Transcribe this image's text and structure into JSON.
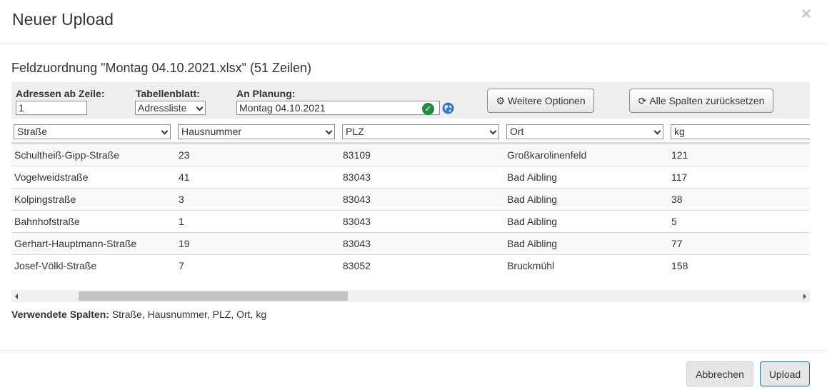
{
  "modal": {
    "title": "Neuer Upload",
    "close_icon": "×"
  },
  "mapping": {
    "subtitle": "Feldzuordnung \"Montag 04.10.2021.xlsx\" (51 Zeilen)"
  },
  "options": {
    "start_row_label": "Adressen ab Zeile:",
    "start_row_value": "1",
    "sheet_label": "Tabellenblatt:",
    "sheet_value": "Adressliste",
    "planning_label": "An Planung:",
    "planning_value": "Montag 04.10.2021",
    "more_options_label": "Weitere Optionen",
    "reset_columns_label": "Alle Spalten zurücksetzen"
  },
  "columns": [
    "Straße",
    "Hausnummer",
    "PLZ",
    "Ort",
    "kg"
  ],
  "rows": [
    [
      "Schultheiß-Gipp-Straße",
      "23",
      "83109",
      "Großkarolinenfeld",
      "121"
    ],
    [
      "Vogelweidstraße",
      "41",
      "83043",
      "Bad Aibling",
      "117"
    ],
    [
      "Kolpingstraße",
      "3",
      "83043",
      "Bad Aibling",
      "38"
    ],
    [
      "Bahnhofstraße",
      "1",
      "83043",
      "Bad Aibling",
      "5"
    ],
    [
      "Gerhart-Hauptmann-Straße",
      "19",
      "83043",
      "Bad Aibling",
      "77"
    ],
    [
      "Josef-Völkl-Straße",
      "7",
      "83052",
      "Bruckmühl",
      "158"
    ]
  ],
  "used_columns": {
    "label": "Verwendete Spalten:",
    "value": "Straße, Hausnummer, PLZ, Ort, kg"
  },
  "footer": {
    "cancel_label": "Abbrechen",
    "upload_label": "Upload"
  },
  "colors": {
    "success": "#1e8e3e",
    "primary_border": "#2e6da4",
    "globe": "#3b78c2"
  },
  "icons": {
    "check": "check-circle-icon",
    "globe": "globe-icon",
    "gear": "gear-icon",
    "refresh": "refresh-icon"
  }
}
